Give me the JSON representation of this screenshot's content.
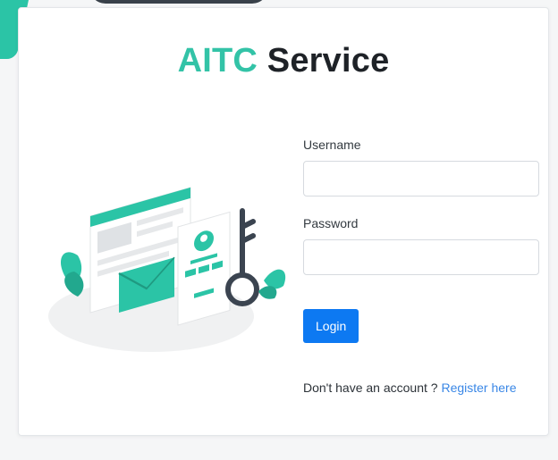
{
  "header": {
    "brand_text": "AITC",
    "title_text": "Service"
  },
  "form": {
    "username_label": "Username",
    "username_value": "",
    "password_label": "Password",
    "password_value": "",
    "login_label": "Login"
  },
  "signup": {
    "prompt_text": "Don't have an account ? ",
    "link_text": "Register here"
  },
  "illustration": {
    "icon": "login-key-illustration"
  },
  "colors": {
    "brand": "#33c3a7",
    "primary_button": "#0d79f2",
    "link": "#3a87e6"
  }
}
